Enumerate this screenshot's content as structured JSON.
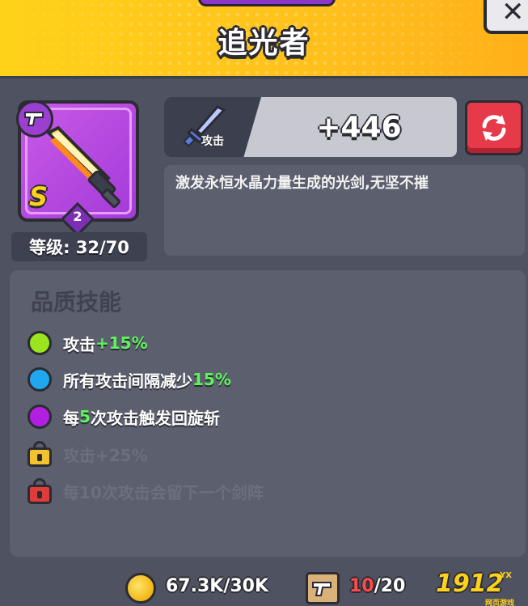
{
  "header": {
    "title": "追光者",
    "close_glyph": "✕"
  },
  "weapon": {
    "rank": "S",
    "stars": "2",
    "level_label": "等级: 32/70",
    "icon": "sword-icon",
    "type_icon": "gun-icon"
  },
  "stat": {
    "label": "攻击",
    "value": "+446",
    "icon": "sword-icon"
  },
  "refresh_icon": "refresh-icon",
  "description": "激发永恒水晶力量生成的光剑,无坚不摧",
  "skills": {
    "title": "品质技能",
    "items": [
      {
        "prefix": "攻击",
        "highlight": "+15%",
        "suffix": "",
        "color": "#9be51f",
        "locked": false
      },
      {
        "prefix": "所有攻击间隔减少",
        "highlight": "15%",
        "suffix": "",
        "color": "#1fa8f0",
        "locked": false
      },
      {
        "prefix": "每",
        "highlight": "5",
        "suffix": "次攻击触发回旋斩",
        "color": "#b31fe0",
        "locked": false
      },
      {
        "text": "攻击+25%",
        "lock_color": "#f2c230",
        "locked": true
      },
      {
        "text": "每10次攻击会留下一个剑阵",
        "lock_color": "#e03a3a",
        "locked": true
      }
    ]
  },
  "footer": {
    "gold": "67.3K/30K",
    "scroll_current": "10",
    "scroll_total": "/20",
    "watermark": "1912",
    "watermark_sub": "YX",
    "watermark_caption": "网页游戏"
  }
}
